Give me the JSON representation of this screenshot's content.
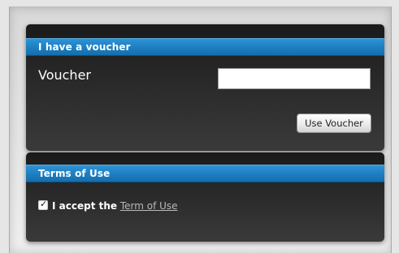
{
  "voucher_panel": {
    "title": "I have a voucher",
    "field_label": "Voucher",
    "input_value": "",
    "button_label": "Use Voucher"
  },
  "terms_panel": {
    "title": "Terms of Use",
    "checkbox_checked": true,
    "accept_prefix": "I accept the",
    "link_text": "Term of Use"
  },
  "icons": {
    "checkbox": "check-icon"
  },
  "colors": {
    "header_blue": "#1c7ec0",
    "panel_dark": "#232323",
    "link_gray": "#b9b9b9"
  }
}
